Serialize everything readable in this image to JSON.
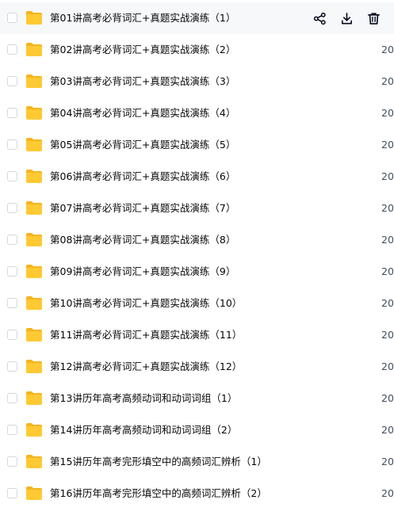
{
  "files": [
    {
      "name": "第01讲高考必背词汇+真题实战演练（1）",
      "date": ""
    },
    {
      "name": "第02讲高考必背词汇+真题实战演练（2）",
      "date": "20"
    },
    {
      "name": "第03讲高考必背词汇+真题实战演练（3）",
      "date": "20"
    },
    {
      "name": "第04讲高考必背词汇+真题实战演练（4）",
      "date": "20"
    },
    {
      "name": "第05讲高考必背词汇+真题实战演练（5）",
      "date": "20"
    },
    {
      "name": "第06讲高考必背词汇+真题实战演练（6）",
      "date": "20"
    },
    {
      "name": "第07讲高考必背词汇+真题实战演练（7）",
      "date": "20"
    },
    {
      "name": "第08讲高考必背词汇+真题实战演练（8）",
      "date": "20"
    },
    {
      "name": "第09讲高考必背词汇+真题实战演练（9）",
      "date": "20"
    },
    {
      "name": "第10讲高考必背词汇+真题实战演练（10）",
      "date": "20"
    },
    {
      "name": "第11讲高考必背词汇+真题实战演练（11）",
      "date": "20"
    },
    {
      "name": "第12讲高考必背词汇+真题实战演练（12）",
      "date": "20"
    },
    {
      "name": "第13讲历年高考高频动词和动词词组（1）",
      "date": "20"
    },
    {
      "name": "第14讲历年高考高频动词和动词词组（2）",
      "date": "20"
    },
    {
      "name": "第15讲历年高考完形填空中的高频词汇辨析（1）",
      "date": "20"
    },
    {
      "name": "第16讲历年高考完形填空中的高频词汇辨析（2）",
      "date": "20"
    }
  ],
  "hover_actions": {
    "share_icon": "share-icon",
    "download_icon": "download-icon",
    "delete_icon": "trash-icon"
  },
  "colors": {
    "folder": "#ffc933",
    "folder_dark": "#f5b520",
    "hover_row": "#f7f8fa",
    "text": "#06070a",
    "muted_text": "#454d5a",
    "icon": "#03081a"
  }
}
